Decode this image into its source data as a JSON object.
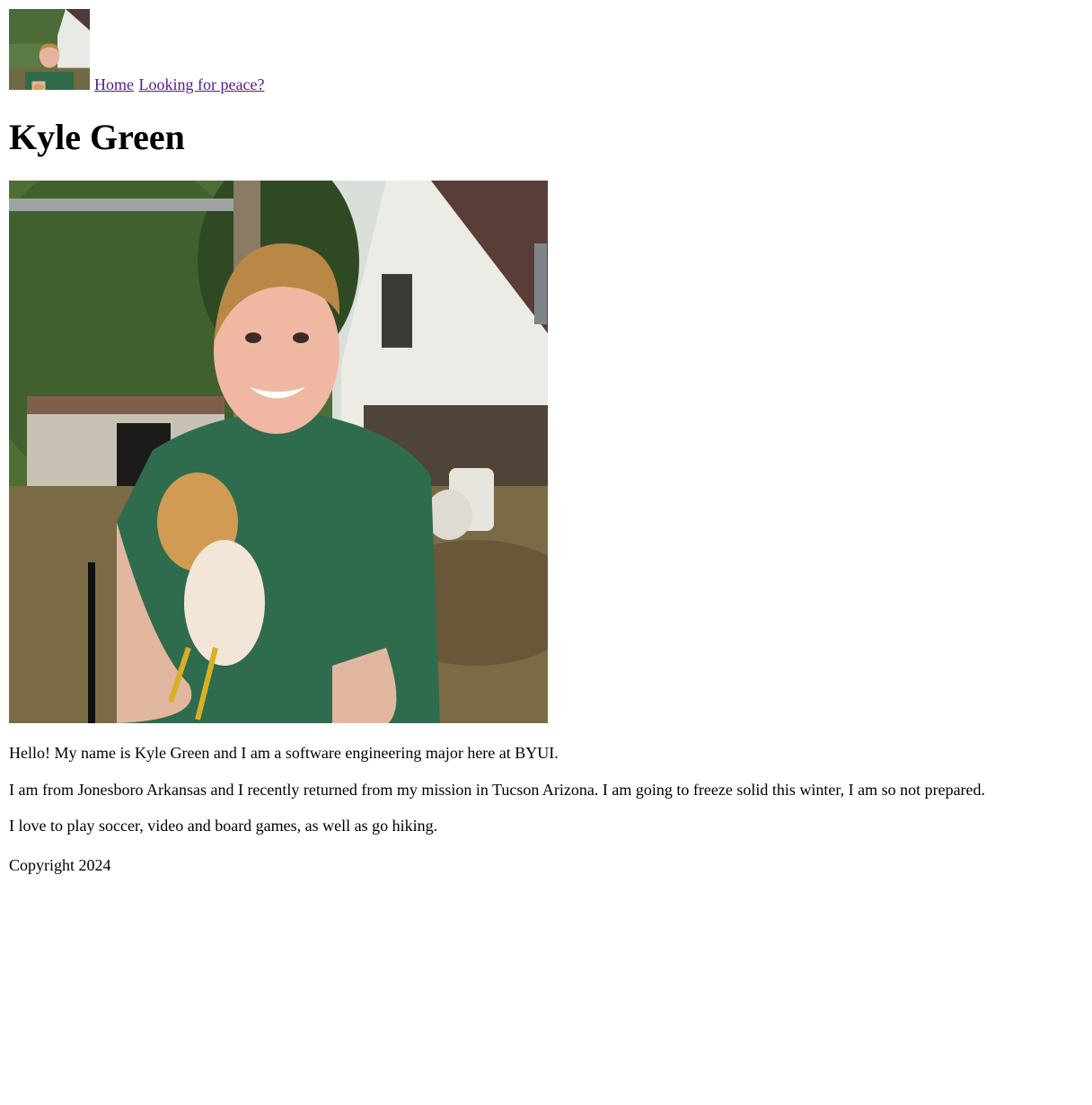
{
  "nav": {
    "home_label": "Home",
    "peace_label": "Looking for peace?",
    "link_color": "#551a8b"
  },
  "page": {
    "title": "Kyle Green"
  },
  "images": {
    "thumbnail": "profile-photo-thumbnail",
    "hero": "profile-photo-holding-chicken"
  },
  "about": {
    "p1": "Hello! My name is Kyle Green and I am a software engineering major here at BYUI.",
    "p2": "I am from Jonesboro Arkansas and I recently returned from my mission in Tucson Arizona. I am going to freeze solid this winter, I am so not prepared.",
    "p3": "I love to play soccer, video and board games, as well as go hiking."
  },
  "footer": {
    "copyright": "Copyright 2024"
  }
}
